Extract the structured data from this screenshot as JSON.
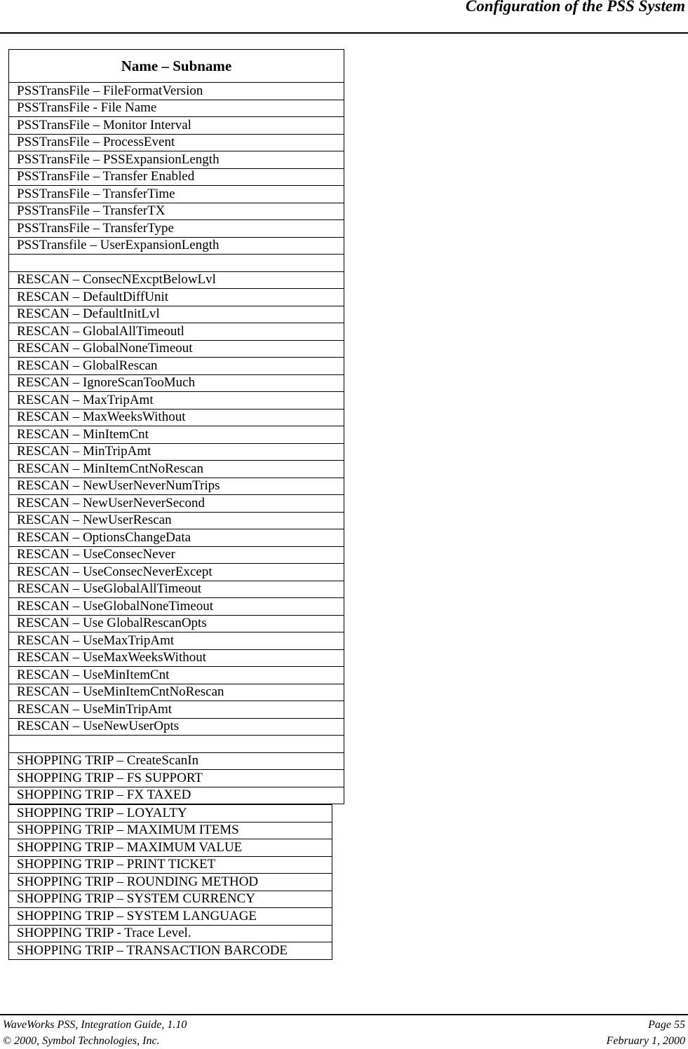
{
  "header": {
    "title": "Configuration of the PSS System"
  },
  "table": {
    "column_header": "Name – Subname",
    "rows_top": [
      "PSSTransFile – FileFormatVersion",
      "PSSTransFile - File Name",
      "PSSTransFile – Monitor Interval",
      "PSSTransFile – ProcessEvent",
      "PSSTransFile – PSSExpansionLength",
      "PSSTransFile – Transfer Enabled",
      "PSSTransFile – TransferTime",
      "PSSTransFile – TransferTX",
      "PSSTransFile – TransferType",
      "PSSTransfile – UserExpansionLength",
      "",
      "RESCAN – ConsecNExcptBelowLvl",
      "RESCAN – DefaultDiffUnit",
      "RESCAN – DefaultInitLvl",
      "RESCAN – GlobalAllTimeoutl",
      "RESCAN – GlobalNoneTimeout",
      "RESCAN – GlobalRescan",
      "RESCAN – IgnoreScanTooMuch",
      "RESCAN – MaxTripAmt",
      "RESCAN – MaxWeeksWithout",
      "RESCAN – MinItemCnt",
      "RESCAN – MinTripAmt",
      "RESCAN – MinItemCntNoRescan",
      "RESCAN – NewUserNeverNumTrips",
      "RESCAN – NewUserNeverSecond",
      "RESCAN – NewUserRescan",
      "RESCAN – OptionsChangeData",
      "RESCAN – UseConsecNever",
      "RESCAN – UseConsecNeverExcept",
      "RESCAN – UseGlobalAllTimeout",
      "RESCAN – UseGlobalNoneTimeout",
      "RESCAN – Use GlobalRescanOpts",
      "RESCAN – UseMaxTripAmt",
      "RESCAN – UseMaxWeeksWithout",
      "RESCAN – UseMinItemCnt",
      "RESCAN – UseMinItemCntNoRescan",
      "RESCAN – UseMinTripAmt",
      "RESCAN – UseNewUserOpts",
      "",
      "SHOPPING TRIP – CreateScanIn",
      "SHOPPING TRIP – FS SUPPORT",
      "SHOPPING TRIP – FX TAXED"
    ],
    "rows_bottom": [
      "SHOPPING TRIP – LOYALTY",
      "SHOPPING TRIP – MAXIMUM ITEMS",
      "SHOPPING TRIP – MAXIMUM VALUE",
      "SHOPPING TRIP – PRINT TICKET",
      "SHOPPING TRIP – ROUNDING METHOD",
      "SHOPPING TRIP – SYSTEM CURRENCY",
      "SHOPPING TRIP – SYSTEM LANGUAGE",
      "SHOPPING TRIP - Trace Level.",
      "SHOPPING TRIP – TRANSACTION BARCODE"
    ]
  },
  "footer": {
    "guide": "WaveWorks PSS, Integration Guide, 1.10",
    "copyright": "© 2000, Symbol Technologies, Inc.",
    "page": "Page 55",
    "date": "February 1, 2000"
  }
}
